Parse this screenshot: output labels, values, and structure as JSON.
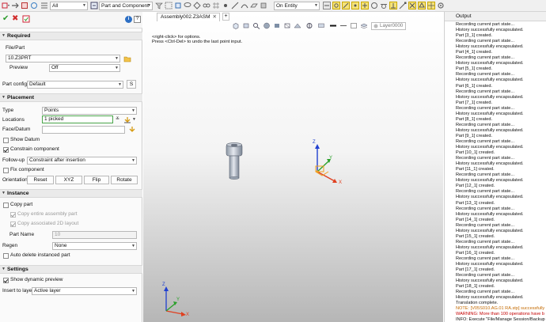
{
  "toolbar": {
    "filter_value": "All",
    "pick_filter_value": "Part and Component",
    "snap_value": "On Entity"
  },
  "panel": {
    "header_icons": [
      "ok-icon",
      "cancel-icon",
      "apply-icon",
      "info-icon",
      "help-icon"
    ],
    "required_title": "Required",
    "file_part_label": "File/Part",
    "file_part_value": "10.Z3PRT",
    "preview_label": "Preview",
    "preview_value": "Off",
    "part_config_label": "Part config",
    "part_config_value": "Default",
    "part_config_btn": "S",
    "placement_title": "Placement",
    "type_label": "Type",
    "type_value": "Points",
    "locations_label": "Locations",
    "locations_value": "1 picked",
    "face_datum_label": "Face/Datum",
    "show_datum_label": "Show Datum",
    "constrain_label": "Constrain component",
    "follow_up_label": "Follow-up",
    "follow_up_value": "Constraint after insertion",
    "fix_label": "Fix component",
    "orientation_label": "Orientation",
    "reset_btn": "Reset",
    "xyz_btn": "XYZ",
    "flip_btn": "Flip",
    "rotate_btn": "Rotate",
    "instance_title": "Instance",
    "copy_part_label": "Copy part",
    "copy_assembly_label": "Copy entire assembly part",
    "copy_2d_label": "Copy associated 2D layout",
    "part_name_label": "Part  Name",
    "part_name_value": "10",
    "regen_label": "Regen",
    "regen_value": "None",
    "auto_delete_label": "Auto delete instanced part",
    "settings_title": "Settings",
    "show_preview_label": "Show dynamic preview",
    "insert_layer_label": "Insert to layer",
    "insert_layer_value": "Active layer"
  },
  "viewport": {
    "tab_title": "Assembly002.Z3ASM",
    "layer_value": "Layer0000",
    "prompt_line1": "<right-click> for options.",
    "prompt_line2": "Press <Ctrl-Del> to undo the last point input.",
    "axis_x": "X",
    "axis_y": "Y",
    "axis_z": "Z"
  },
  "output": {
    "title": "Output",
    "lines": [
      {
        "text": "Recording current part state...",
        "kind": "normal"
      },
      {
        "text": "History successfully encapsulated.",
        "kind": "normal"
      },
      {
        "text": "Part [3_1] created.",
        "kind": "normal"
      },
      {
        "text": "Recording current part state...",
        "kind": "normal"
      },
      {
        "text": "History successfully encapsulated.",
        "kind": "normal"
      },
      {
        "text": "Part [4_1] created.",
        "kind": "normal"
      },
      {
        "text": "Recording current part state...",
        "kind": "normal"
      },
      {
        "text": "History successfully encapsulated.",
        "kind": "normal"
      },
      {
        "text": "Part [5_1] created.",
        "kind": "normal"
      },
      {
        "text": "Recording current part state...",
        "kind": "normal"
      },
      {
        "text": "History successfully encapsulated.",
        "kind": "normal"
      },
      {
        "text": "Part [6_1] created.",
        "kind": "normal"
      },
      {
        "text": "Recording current part state...",
        "kind": "normal"
      },
      {
        "text": "History successfully encapsulated.",
        "kind": "normal"
      },
      {
        "text": "Part [7_1] created.",
        "kind": "normal"
      },
      {
        "text": "Recording current part state...",
        "kind": "normal"
      },
      {
        "text": "History successfully encapsulated.",
        "kind": "normal"
      },
      {
        "text": "Part [8_1] created.",
        "kind": "normal"
      },
      {
        "text": "Recording current part state...",
        "kind": "normal"
      },
      {
        "text": "History successfully encapsulated.",
        "kind": "normal"
      },
      {
        "text": "Part [9_1] created.",
        "kind": "normal"
      },
      {
        "text": "Recording current part state...",
        "kind": "normal"
      },
      {
        "text": "History successfully encapsulated.",
        "kind": "normal"
      },
      {
        "text": "Part [10_1] created.",
        "kind": "normal"
      },
      {
        "text": "Recording current part state...",
        "kind": "normal"
      },
      {
        "text": "History successfully encapsulated.",
        "kind": "normal"
      },
      {
        "text": "Part [11_1] created.",
        "kind": "normal"
      },
      {
        "text": "Recording current part state...",
        "kind": "normal"
      },
      {
        "text": "History successfully encapsulated.",
        "kind": "normal"
      },
      {
        "text": "Part [12_1] created.",
        "kind": "normal"
      },
      {
        "text": "Recording current part state...",
        "kind": "normal"
      },
      {
        "text": "History successfully encapsulated.",
        "kind": "normal"
      },
      {
        "text": "Part [13_1] created.",
        "kind": "normal"
      },
      {
        "text": "Recording current part state...",
        "kind": "normal"
      },
      {
        "text": "History successfully encapsulated.",
        "kind": "normal"
      },
      {
        "text": "Part [14_1] created.",
        "kind": "normal"
      },
      {
        "text": "Recording current part state...",
        "kind": "normal"
      },
      {
        "text": "History successfully encapsulated.",
        "kind": "normal"
      },
      {
        "text": "Part [15_1] created.",
        "kind": "normal"
      },
      {
        "text": "Recording current part state...",
        "kind": "normal"
      },
      {
        "text": "History successfully encapsulated.",
        "kind": "normal"
      },
      {
        "text": "Part [16_1] created.",
        "kind": "normal"
      },
      {
        "text": "Recording current part state...",
        "kind": "normal"
      },
      {
        "text": "History successfully encapsulated.",
        "kind": "normal"
      },
      {
        "text": "Part [17_1] created.",
        "kind": "normal"
      },
      {
        "text": "Recording current part state...",
        "kind": "normal"
      },
      {
        "text": "History successfully encapsulated.",
        "kind": "normal"
      },
      {
        "text": "Part [18_1] created.",
        "kind": "normal"
      },
      {
        "text": "Recording current part state...",
        "kind": "normal"
      },
      {
        "text": "History successfully encapsulated.",
        "kind": "normal"
      },
      {
        "text": "Translation complete.",
        "kind": "normal"
      },
      {
        "text": "NOTE: [V05S010.AG.01 RA.stp] successfully i",
        "kind": "note"
      },
      {
        "text": "WARNING: More than 100 operations have b",
        "kind": "warn"
      },
      {
        "text": "INFO: Execute \"File/Manage Session/Backup",
        "kind": "normal"
      }
    ]
  },
  "colors": {
    "accent_green": "#4aa64a",
    "section_bg": "#eaeaea",
    "note": "#c46a00",
    "warning": "#c40000",
    "axis_x": "#e04020",
    "axis_y": "#2aa02a",
    "axis_z": "#2040d0"
  }
}
